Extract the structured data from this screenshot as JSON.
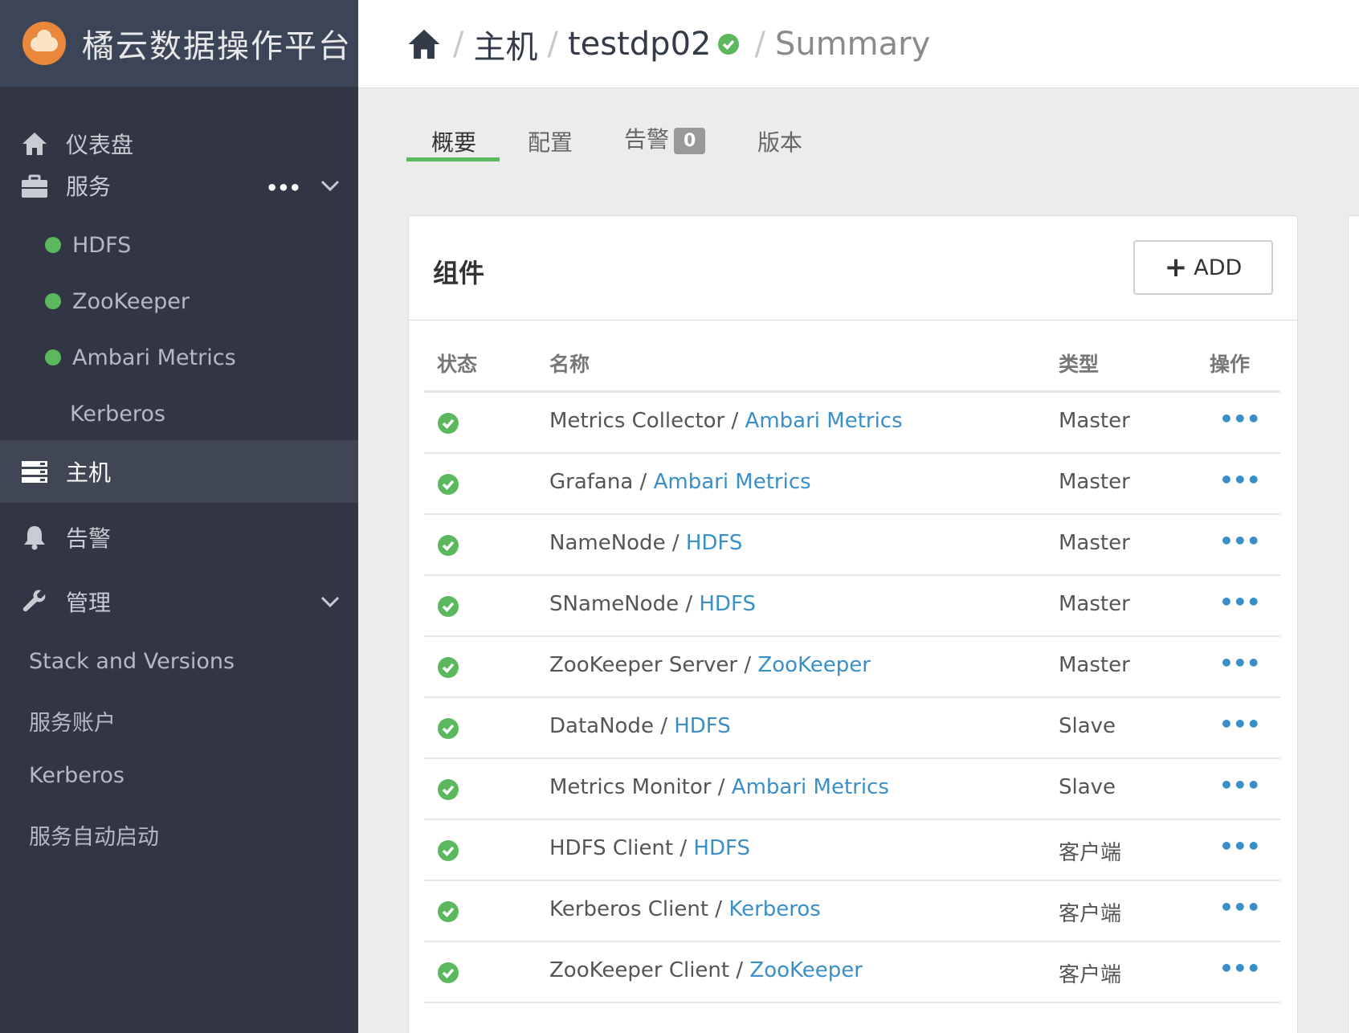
{
  "brand": {
    "title": "橘云数据操作平台",
    "logo_icon": "cloud-logo-icon"
  },
  "sidebar": {
    "dashboard": {
      "label": "仪表盘",
      "icon": "home-icon"
    },
    "services": {
      "label": "服务",
      "icon": "briefcase-icon",
      "more": "•••",
      "items": [
        {
          "label": "HDFS",
          "status": "ok"
        },
        {
          "label": "ZooKeeper",
          "status": "ok"
        },
        {
          "label": "Ambari Metrics",
          "status": "ok"
        },
        {
          "label": "Kerberos",
          "status": "none"
        }
      ]
    },
    "hosts": {
      "label": "主机",
      "icon": "server-icon"
    },
    "alerts": {
      "label": "告警",
      "icon": "bell-icon"
    },
    "admin": {
      "label": "管理",
      "icon": "wrench-icon",
      "items": [
        "Stack and Versions",
        "服务账户",
        "Kerberos",
        "服务自动启动"
      ]
    }
  },
  "breadcrumb": {
    "host_section": "主机",
    "host_name": "testdp02",
    "page": "Summary"
  },
  "tabs": [
    {
      "label": "概要",
      "active": true
    },
    {
      "label": "配置",
      "active": false
    },
    {
      "label": "告警",
      "badge": "0",
      "active": false
    },
    {
      "label": "版本",
      "active": false
    }
  ],
  "components": {
    "title": "组件",
    "add_label": "ADD",
    "columns": {
      "status": "状态",
      "name": "名称",
      "type": "类型",
      "action": "操作"
    },
    "more": "•••",
    "rows": [
      {
        "name": "Metrics Collector",
        "service": "Ambari Metrics",
        "type": "Master"
      },
      {
        "name": "Grafana",
        "service": "Ambari Metrics",
        "type": "Master"
      },
      {
        "name": "NameNode",
        "service": "HDFS",
        "type": "Master"
      },
      {
        "name": "SNameNode",
        "service": "HDFS",
        "type": "Master"
      },
      {
        "name": "ZooKeeper Server",
        "service": "ZooKeeper",
        "type": "Master"
      },
      {
        "name": "DataNode",
        "service": "HDFS",
        "type": "Slave"
      },
      {
        "name": "Metrics Monitor",
        "service": "Ambari Metrics",
        "type": "Slave"
      },
      {
        "name": "HDFS Client",
        "service": "HDFS",
        "type": "客户端"
      },
      {
        "name": "Kerberos Client",
        "service": "Kerberos",
        "type": "客户端"
      },
      {
        "name": "ZooKeeper Client",
        "service": "ZooKeeper",
        "type": "客户端"
      }
    ]
  },
  "colors": {
    "sidebar_bg": "#323544",
    "brand_bg": "#3b4557",
    "accent_green": "#5cb85c",
    "link_blue": "#3a8fc9"
  }
}
